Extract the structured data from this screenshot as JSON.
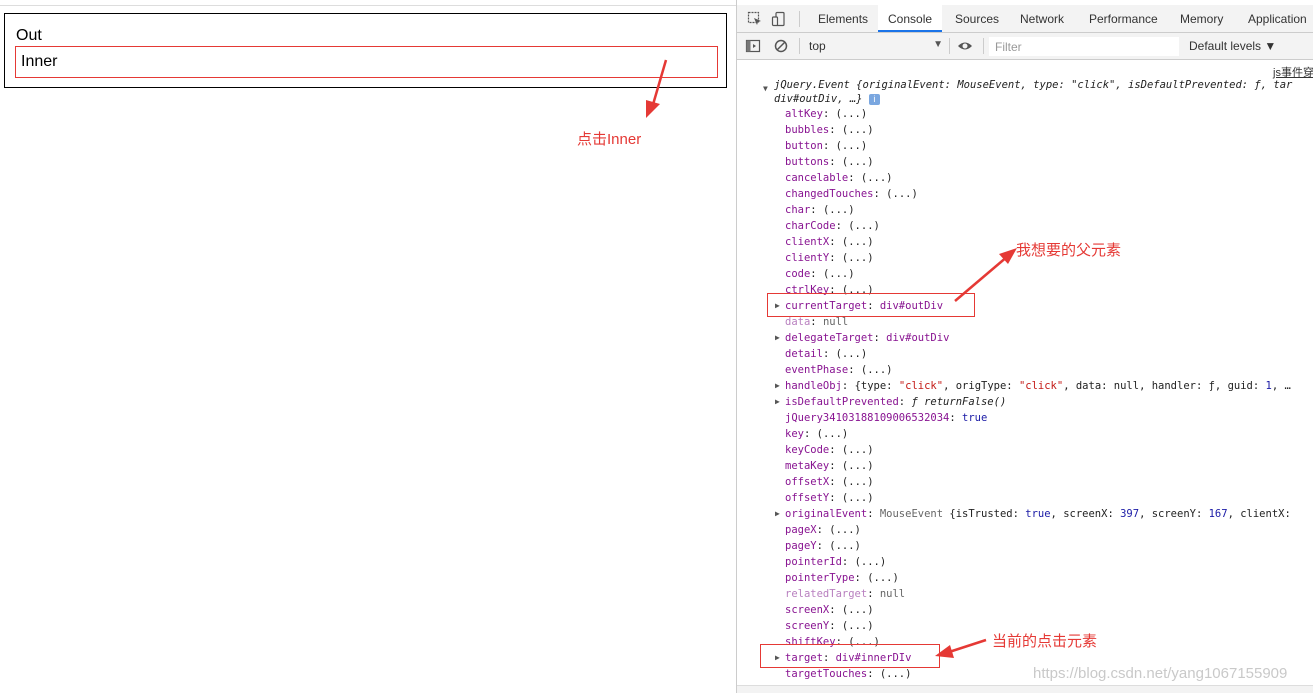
{
  "page": {
    "out_label": "Out",
    "inner_label": "Inner",
    "annotation_click_inner": "点击Inner",
    "annotation_parent": "我想要的父元素",
    "annotation_current": "当前的点击元素",
    "accent_color": "#e53935"
  },
  "devtools": {
    "tabs": [
      "Elements",
      "Console",
      "Sources",
      "Network",
      "Performance",
      "Memory",
      "Application"
    ],
    "active_tab": "Console",
    "toolbar": {
      "context": "top",
      "filter_placeholder": "Filter",
      "levels": "Default levels ▼"
    },
    "source_link": "js事件穿",
    "event_head": {
      "line1": "jQuery.Event {originalEvent: MouseEvent, type: \"click\", isDefaultPrevented: ƒ, tar",
      "line2": "div#outDiv, …}",
      "info": "i"
    },
    "props": {
      "altKey": "altKey",
      "bubbles": "bubbles",
      "button": "button",
      "buttons": "buttons",
      "cancelable": "cancelable",
      "changedTouches": "changedTouches",
      "char": "char",
      "charCode": "charCode",
      "clientX": "clientX",
      "clientY": "clientY",
      "code": "code",
      "ctrlKey": "ctrlKey",
      "currentTarget": "currentTarget",
      "currentTarget_val": "div#outDiv",
      "data": "data",
      "null": "null",
      "delegateTarget": "delegateTarget",
      "delegateTarget_val": "div#outDiv",
      "detail": "detail",
      "eventPhase": "eventPhase",
      "handleObj": "handleObj",
      "handleObj_p1": "{type: ",
      "click": "\"click\"",
      "handleObj_p2": ", origType: ",
      "handleObj_p3": ", data: null, handler: ƒ, guid: ",
      "one": "1",
      "ellipsis": ", …",
      "isDefaultPrevented": "isDefaultPrevented",
      "returnFalse": "ƒ returnFalse()",
      "jqueryKey": "jQuery34103188109006532034",
      "true": "true",
      "key": "key",
      "keyCode": "keyCode",
      "metaKey": "metaKey",
      "offsetX": "offsetX",
      "offsetY": "offsetY",
      "originalEvent": "originalEvent",
      "oe_type": "MouseEvent",
      "oe_p1": " {isTrusted: ",
      "oe_p2": ", screenX: ",
      "screenX_val": "397",
      "oe_p3": ", screenY: ",
      "screenY_val": "167",
      "oe_p4": ", clientX: ",
      "pageX": "pageX",
      "pageY": "pageY",
      "pointerId": "pointerId",
      "pointerType": "pointerType",
      "relatedTarget": "relatedTarget",
      "screenX": "screenX",
      "screenY": "screenY",
      "shiftKey": "shiftKey",
      "target": "target",
      "target_val": "div#innerDIv",
      "targetTouches": "targetTouches",
      "colon": ": ",
      "lazy": "(...)"
    },
    "watermark": "https://blog.csdn.net/yang1067155909"
  }
}
